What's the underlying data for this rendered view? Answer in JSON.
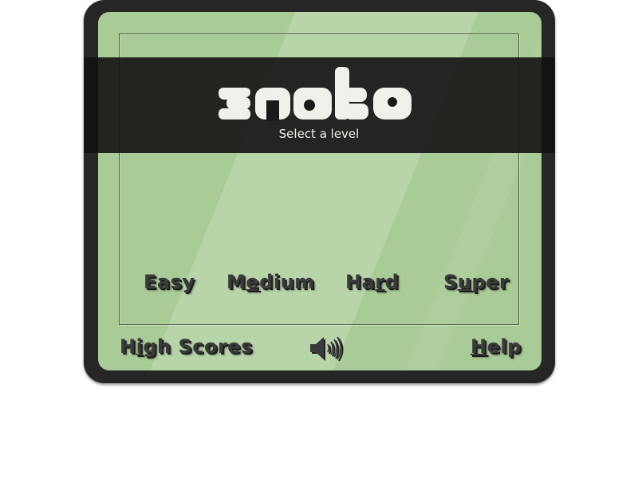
{
  "game": {
    "title": "snake",
    "subtitle": "Select a level"
  },
  "levels": [
    {
      "pre": "Easy",
      "key": "",
      "post": ""
    },
    {
      "pre": "M",
      "key": "e",
      "post": "dium"
    },
    {
      "pre": "Ha",
      "key": "r",
      "post": "d"
    },
    {
      "pre": "S",
      "key": "u",
      "post": "per"
    }
  ],
  "footer": {
    "high_scores": {
      "pre": "H",
      "key": "i",
      "post": "gh Scores"
    },
    "help": {
      "pre": "",
      "key": "H",
      "post": "elp"
    },
    "sound_icon": "speaker-icon"
  },
  "colors": {
    "lcd": "#a9cb97",
    "body": "#262626",
    "banner": "#121212",
    "logo": "#eef2ea",
    "button_text": "#3a3a3a"
  }
}
